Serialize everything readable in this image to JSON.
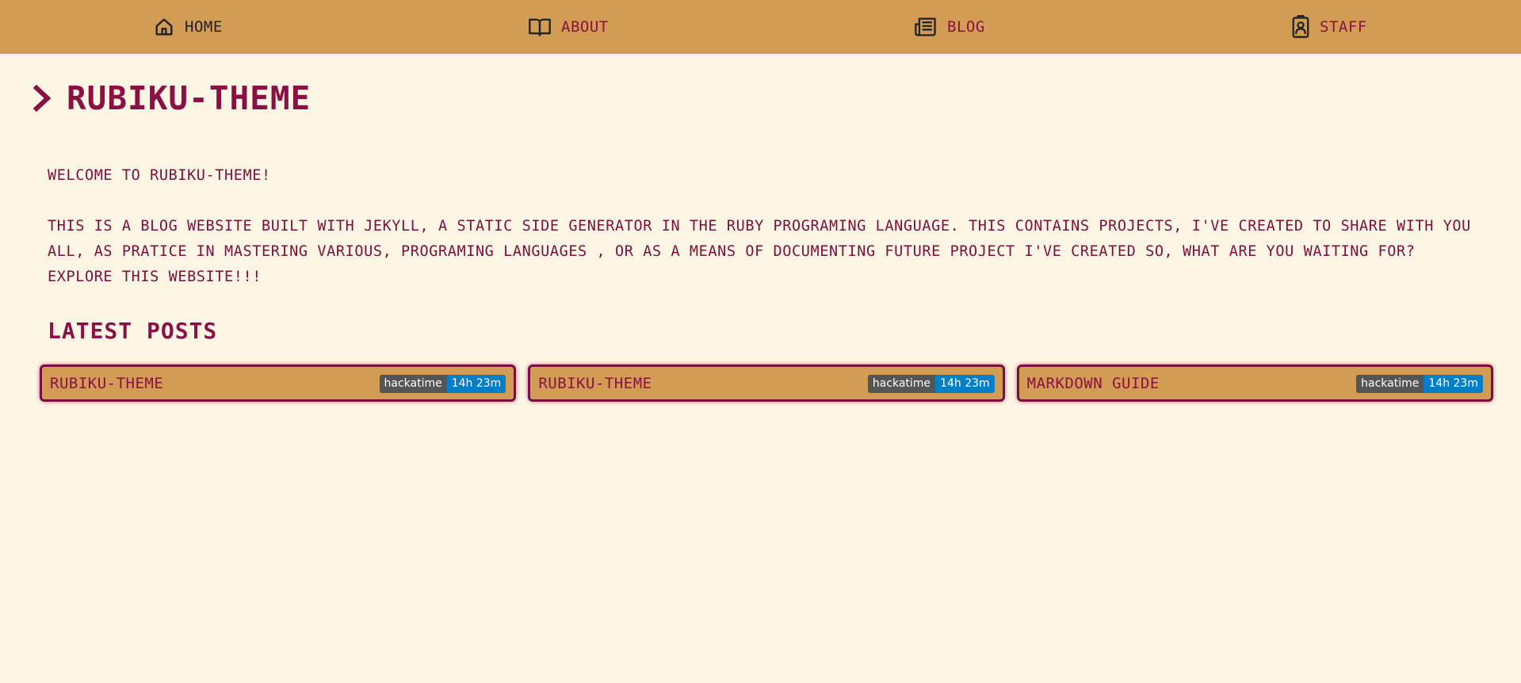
{
  "nav": {
    "items": [
      {
        "label": "HOME",
        "icon": "home-icon"
      },
      {
        "label": "ABOUT",
        "icon": "book-icon"
      },
      {
        "label": "BLOG",
        "icon": "newspaper-icon"
      },
      {
        "label": "STAFF",
        "icon": "id-badge-icon"
      }
    ]
  },
  "page": {
    "title": "RUBIKU-THEME",
    "welcome": "WELCOME TO RUBIKU-THEME!",
    "description": "THIS IS A BLOG WEBSITE BUILT WITH JEKYLL, A STATIC SIDE GENERATOR IN THE RUBY PROGRAMING LANGUAGE. THIS CONTAINS PROJECTS, I'VE CREATED TO SHARE WITH YOU ALL, AS PRATICE IN MASTERING VARIOUS, PROGRAMING LANGUAGES , OR AS A MEANS OF DOCUMENTING FUTURE PROJECT I'VE CREATED SO, WHAT ARE YOU WAITING FOR? EXPLORE THIS WEBSITE!!!"
  },
  "latest": {
    "heading": "LATEST POSTS",
    "posts": [
      {
        "title": "RUBIKU-THEME",
        "badge_label": "hackatime",
        "badge_value": "14h 23m"
      },
      {
        "title": "RUBIKU-THEME",
        "badge_label": "hackatime",
        "badge_value": "14h 23m"
      },
      {
        "title": "MARKDOWN GUIDE",
        "badge_label": "hackatime",
        "badge_value": "14h 23m"
      }
    ]
  },
  "colors": {
    "nav_bg": "#d39c54",
    "page_bg": "#fef6e4",
    "accent": "#8a1143",
    "badge_left": "#555555",
    "badge_right": "#007ec6"
  }
}
